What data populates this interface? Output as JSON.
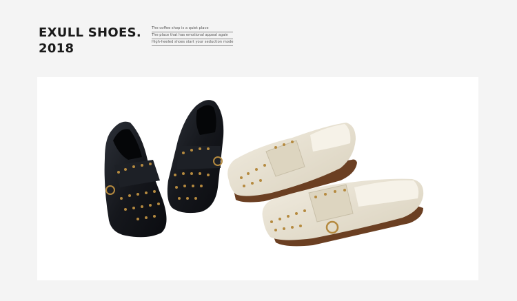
{
  "brand": {
    "line1": "EXULL SHOES.",
    "line2": "2018"
  },
  "taglines": [
    "The coffee shop is a quiet place",
    "The place that has emotional appeal again",
    "High-heeled shoes start your seduction mode"
  ],
  "product_photo": {
    "subject": "studded square-toe loafers",
    "colors": {
      "black_leather": "#15171c",
      "cream_leather": "#e6e0cf",
      "stud": "#b58a3f",
      "sole": "#6b3f22"
    }
  }
}
